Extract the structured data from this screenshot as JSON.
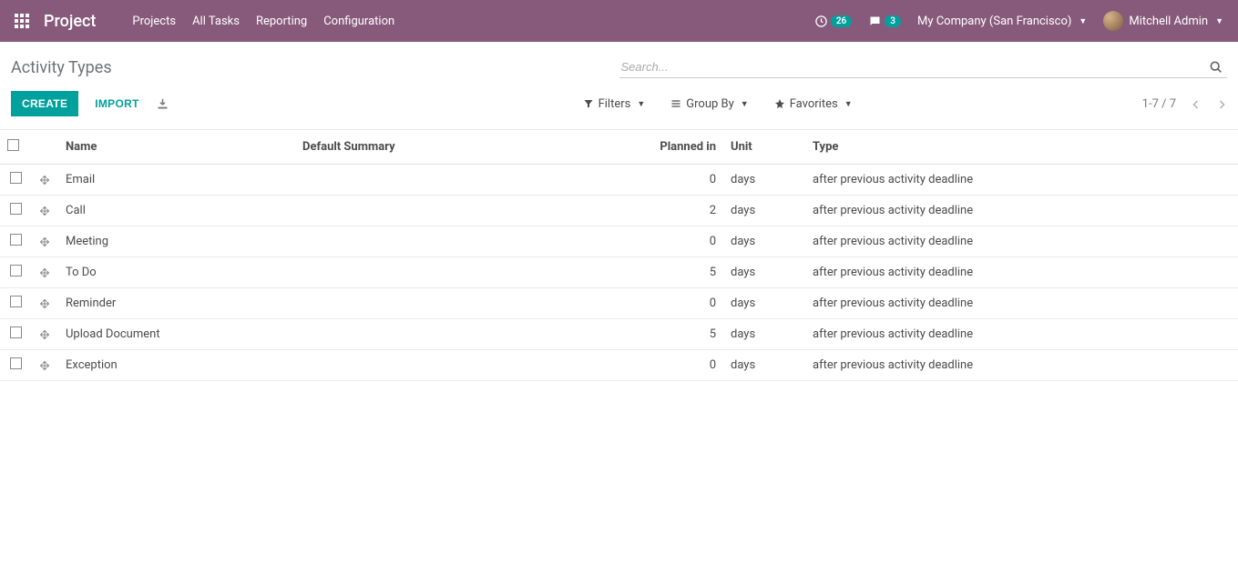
{
  "navbar": {
    "brand": "Project",
    "links": [
      "Projects",
      "All Tasks",
      "Reporting",
      "Configuration"
    ],
    "activities_count": "26",
    "messages_count": "3",
    "company": "My Company (San Francisco)",
    "user": "Mitchell Admin"
  },
  "breadcrumb": "Activity Types",
  "search": {
    "placeholder": "Search..."
  },
  "buttons": {
    "create": "CREATE",
    "import": "IMPORT"
  },
  "toolbar": {
    "filters": "Filters",
    "group_by": "Group By",
    "favorites": "Favorites"
  },
  "pager": "1-7 / 7",
  "table": {
    "headers": {
      "name": "Name",
      "default_summary": "Default Summary",
      "planned_in": "Planned in",
      "unit": "Unit",
      "type": "Type"
    },
    "rows": [
      {
        "name": "Email",
        "summary": "",
        "planned": "0",
        "unit": "days",
        "type": "after previous activity deadline"
      },
      {
        "name": "Call",
        "summary": "",
        "planned": "2",
        "unit": "days",
        "type": "after previous activity deadline"
      },
      {
        "name": "Meeting",
        "summary": "",
        "planned": "0",
        "unit": "days",
        "type": "after previous activity deadline"
      },
      {
        "name": "To Do",
        "summary": "",
        "planned": "5",
        "unit": "days",
        "type": "after previous activity deadline"
      },
      {
        "name": "Reminder",
        "summary": "",
        "planned": "0",
        "unit": "days",
        "type": "after previous activity deadline"
      },
      {
        "name": "Upload Document",
        "summary": "",
        "planned": "5",
        "unit": "days",
        "type": "after previous activity deadline"
      },
      {
        "name": "Exception",
        "summary": "",
        "planned": "0",
        "unit": "days",
        "type": "after previous activity deadline"
      }
    ]
  }
}
